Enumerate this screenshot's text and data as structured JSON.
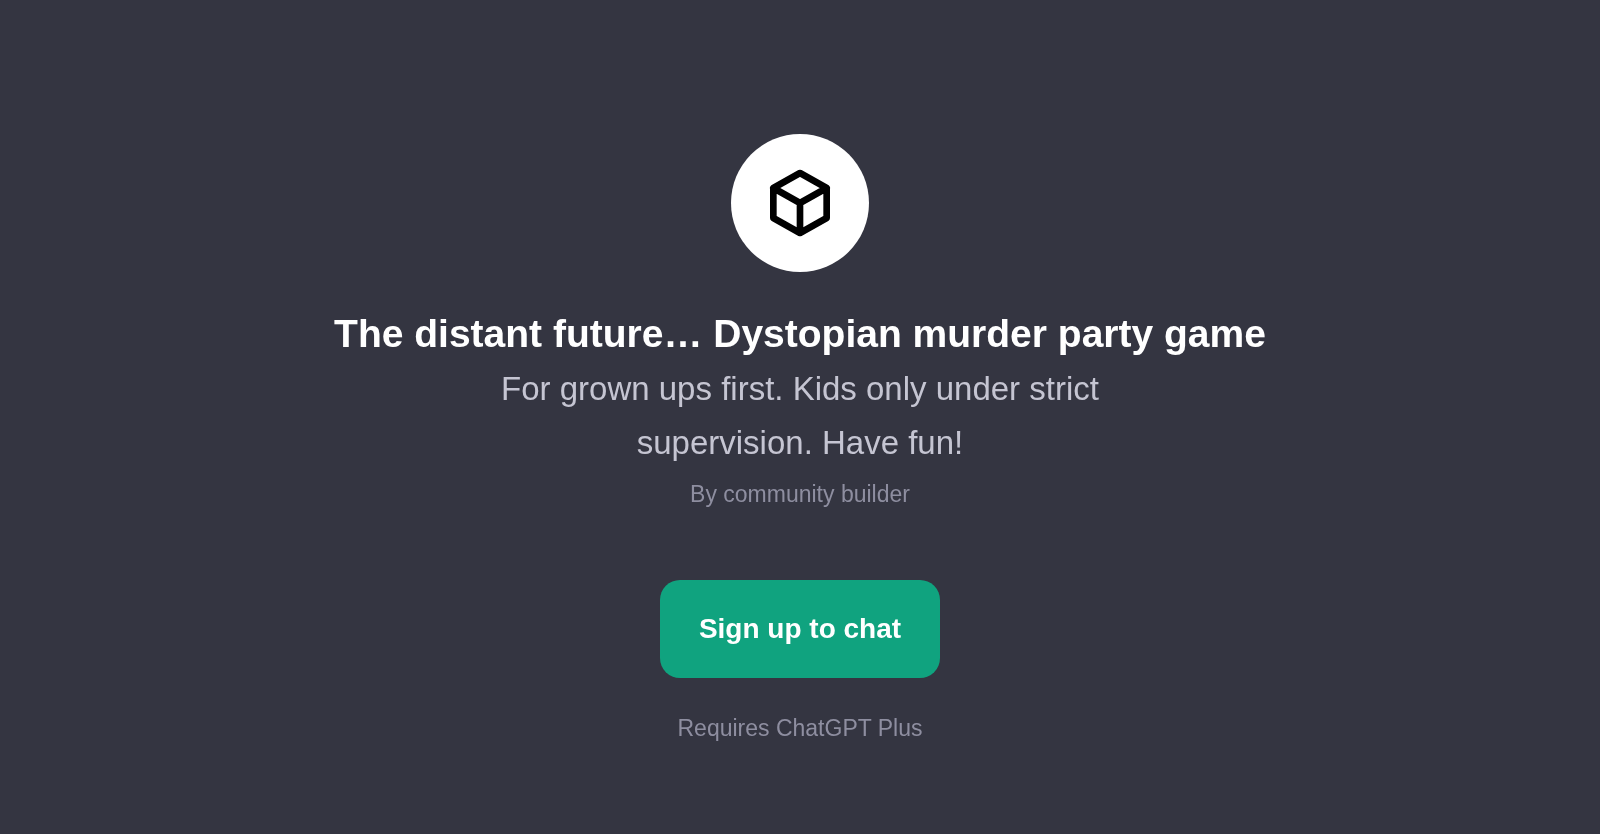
{
  "title": "The distant future… Dystopian murder party game",
  "description": "For grown ups first. Kids only under strict supervision. Have fun!",
  "byline": "By community builder",
  "button": "Sign up to chat",
  "note": "Requires ChatGPT Plus"
}
